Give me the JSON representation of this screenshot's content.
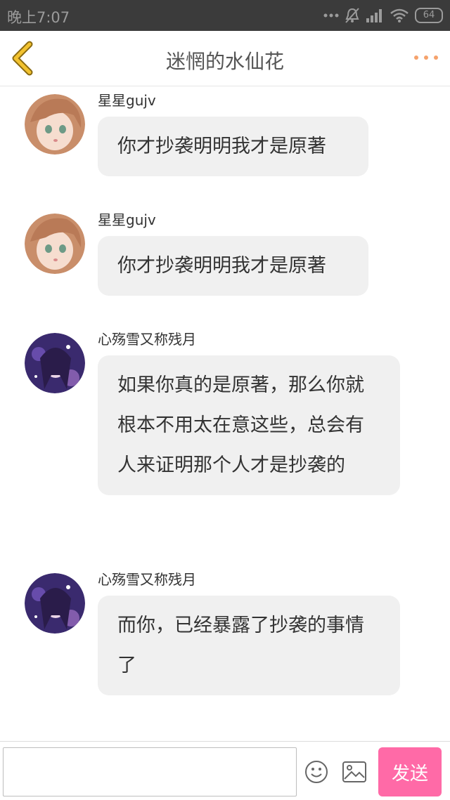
{
  "status_bar": {
    "time": "晚上7:07",
    "battery": "64"
  },
  "header": {
    "title": "迷惘的水仙花"
  },
  "messages": [
    {
      "sender": "星星gujv",
      "text": "你才抄袭明明我才是原著",
      "avatar": "avatar-anime-girl-brown-hair"
    },
    {
      "sender": "星星gujv",
      "text": "你才抄袭明明我才是原著",
      "avatar": "avatar-anime-girl-brown-hair"
    },
    {
      "sender": "心殇雪又称残月",
      "text": "如果你真的是原著，那么你就根本不用太在意这些，总会有人来证明那个人才是抄袭的",
      "avatar": "avatar-anime-girl-purple"
    },
    {
      "sender": "心殇雪又称残月",
      "text": "而你，已经暴露了抄袭的事情了",
      "avatar": "avatar-anime-girl-purple"
    }
  ],
  "composer": {
    "value": "",
    "send_label": "发送"
  },
  "colors": {
    "accent": "#ff6aa7",
    "back_arrow": "#f2c230",
    "more_dots": "#f5a26c",
    "bubble": "#f0f0f0"
  },
  "icons": [
    "back-arrow-icon",
    "more-icon",
    "emoji-icon",
    "image-icon",
    "signal-icon",
    "wifi-icon",
    "mute-icon"
  ]
}
